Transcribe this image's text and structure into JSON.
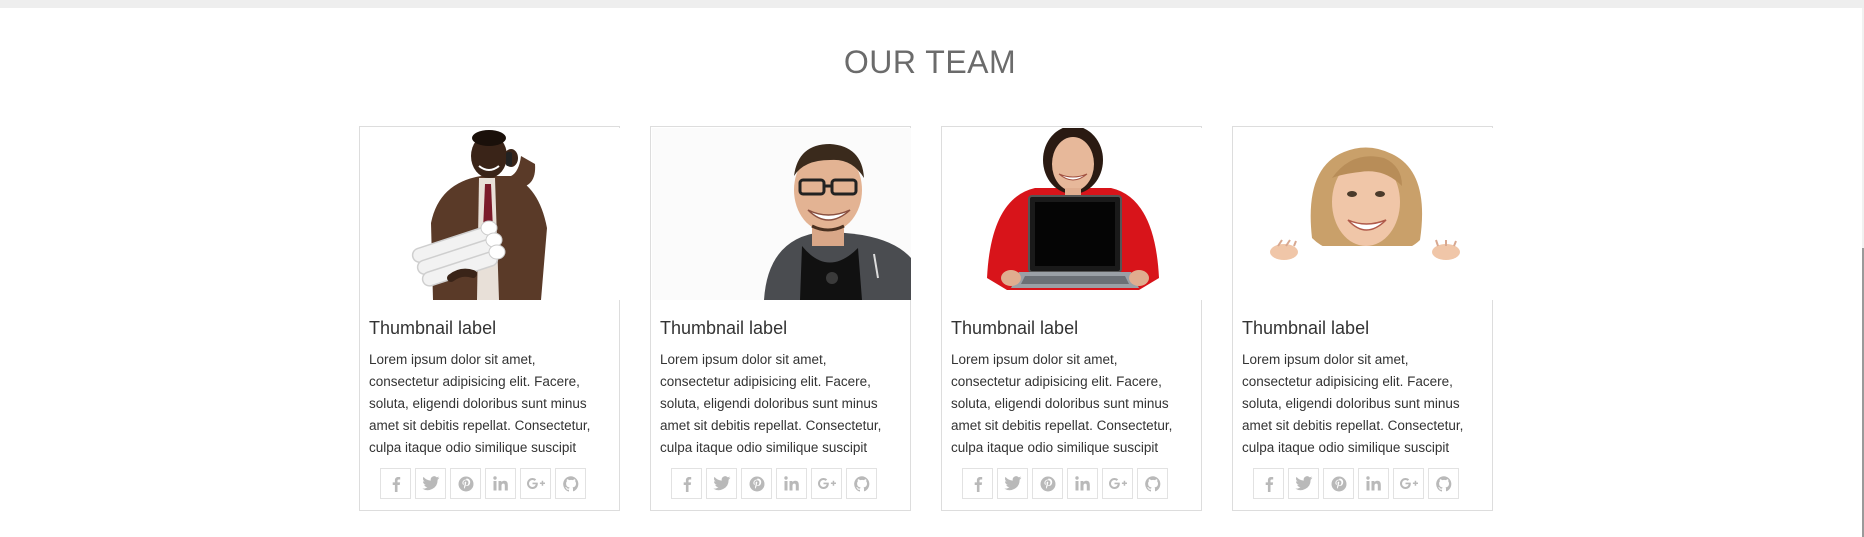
{
  "section": {
    "title": "OUR TEAM"
  },
  "cards": [
    {
      "label": "Thumbnail label",
      "text": "Lorem ipsum dolor sit amet, consectetur adipisicing elit. Facere, soluta, eligendi doloribus sunt minus amet sit debitis repellat. Consectetur, culpa itaque odio similique suscipit",
      "photo": "businessman-on-phone-photo"
    },
    {
      "label": "Thumbnail label",
      "text": "Lorem ipsum dolor sit amet, consectetur adipisicing elit. Facere, soluta, eligendi doloribus sunt minus amet sit debitis repellat. Consectetur, culpa itaque odio similique suscipit",
      "photo": "smiling-man-glasses-photo"
    },
    {
      "label": "Thumbnail label",
      "text": "Lorem ipsum dolor sit amet, consectetur adipisicing elit. Facere, soluta, eligendi doloribus sunt minus amet sit debitis repellat. Consectetur, culpa itaque odio similique suscipit",
      "photo": "woman-with-laptop-photo"
    },
    {
      "label": "Thumbnail label",
      "text": "Lorem ipsum dolor sit amet, consectetur adipisicing elit. Facere, soluta, eligendi doloribus sunt minus amet sit debitis repellat. Consectetur, culpa itaque odio similique suscipit",
      "photo": "smiling-blonde-woman-photo"
    }
  ],
  "social_icons": [
    "facebook-icon",
    "twitter-icon",
    "pinterest-icon",
    "linkedin-icon",
    "google-plus-icon",
    "github-icon"
  ],
  "colors": {
    "title": "#6b6b6b",
    "border": "#dddddd",
    "icon": "#b9b9b9"
  }
}
